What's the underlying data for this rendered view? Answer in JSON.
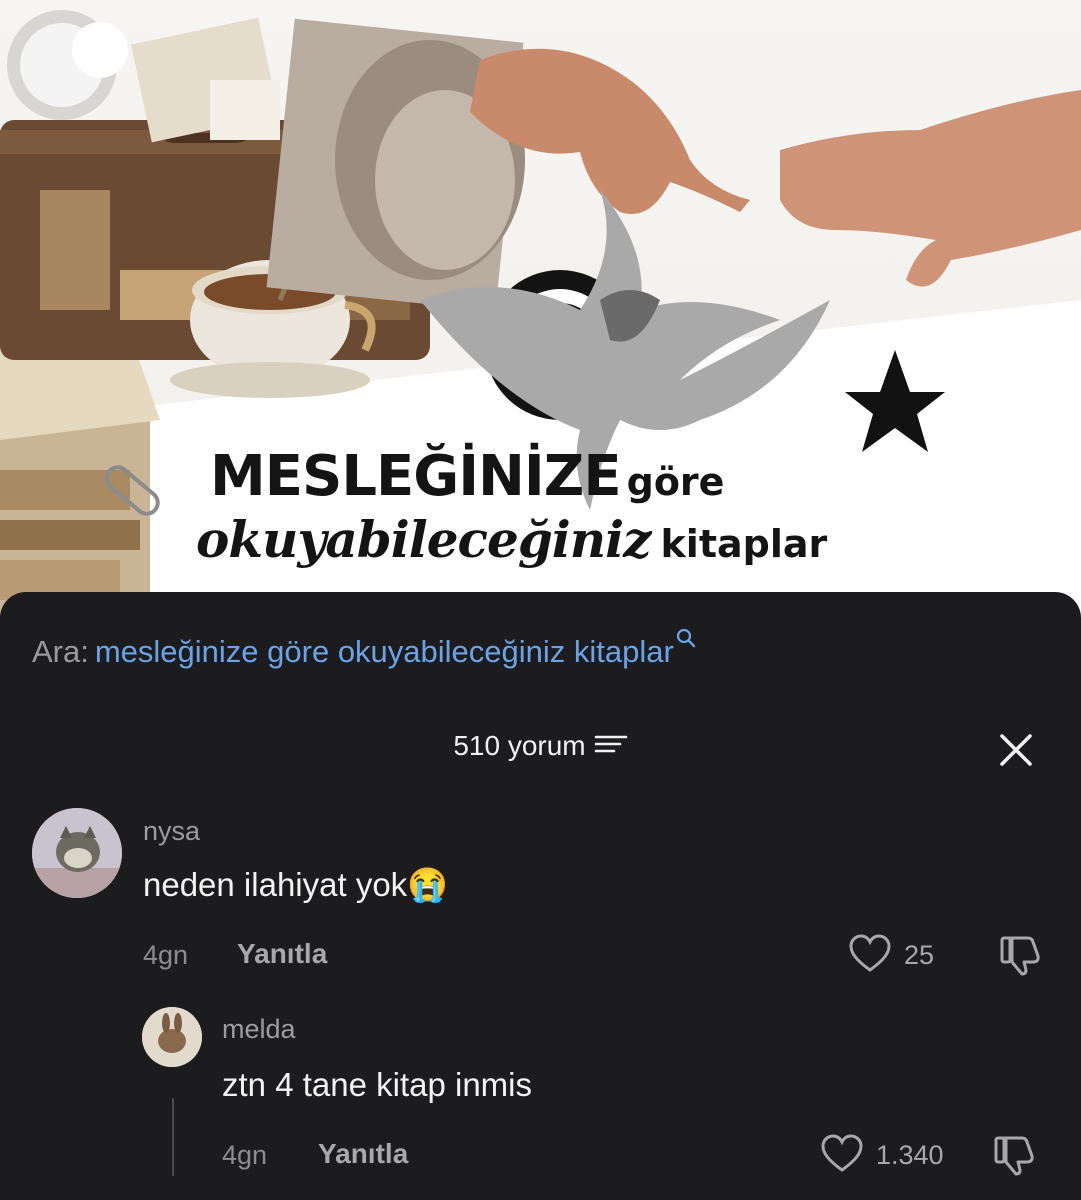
{
  "hero": {
    "title_main": "MESLEĞİNİZE",
    "title_small": "göre",
    "subtitle_script": "okuyabileceğiniz",
    "subtitle_sans": "kitaplar"
  },
  "search": {
    "prefix": "Ara:",
    "query": "mesleğinize göre okuyabileceğiniz kitaplar"
  },
  "comments_header": {
    "count_label": "510 yorum"
  },
  "comments": [
    {
      "username": "nysa",
      "text": "neden ilahiyat yok😭",
      "time": "4gn",
      "reply_label": "Yanıtla",
      "likes": "25"
    },
    {
      "username": "melda",
      "text": "ztn 4 tane kitap inmis",
      "time": "4gn",
      "reply_label": "Yanıtla",
      "likes": "1.340"
    }
  ],
  "colors": {
    "sheet_bg": "#1c1c1e",
    "link_blue": "#6aa3e6",
    "muted_text": "#9d9da1"
  },
  "icons": [
    "search-icon",
    "filter-icon",
    "close-icon",
    "heart-icon",
    "dislike-icon"
  ]
}
